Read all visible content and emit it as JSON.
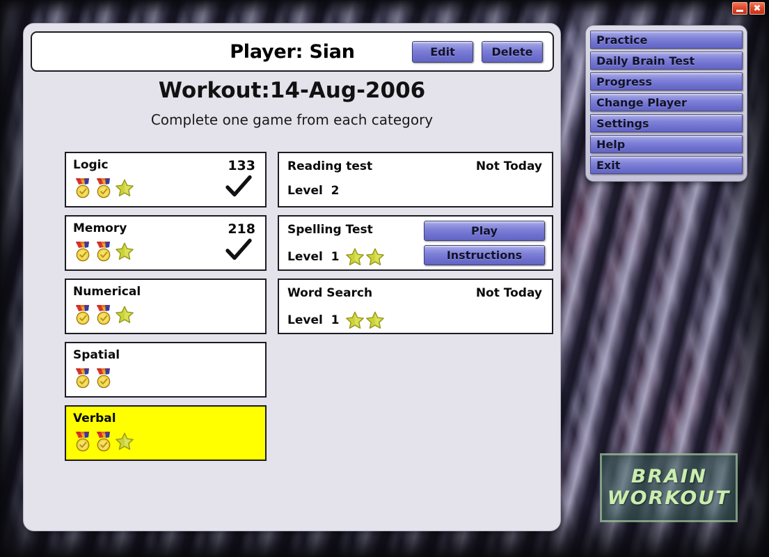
{
  "titlebar": {
    "minimize_label": "minimize",
    "close_label": "✖"
  },
  "header": {
    "player_label": "Player: Sian",
    "edit_label": "Edit",
    "delete_label": "Delete"
  },
  "workout": {
    "title": "Workout:14-Aug-2006",
    "subtitle": "Complete one game from each category"
  },
  "categories": [
    {
      "name": "Logic",
      "score": "133",
      "medals": 2,
      "stars": 1,
      "completed": true,
      "highlighted": false
    },
    {
      "name": "Memory",
      "score": "218",
      "medals": 2,
      "stars": 1,
      "completed": true,
      "highlighted": false
    },
    {
      "name": "Numerical",
      "score": "",
      "medals": 2,
      "stars": 1,
      "completed": false,
      "highlighted": false
    },
    {
      "name": "Spatial",
      "score": "",
      "medals": 2,
      "stars": 0,
      "completed": false,
      "highlighted": false
    },
    {
      "name": "Verbal",
      "score": "",
      "medals": 2,
      "stars": 1,
      "completed": false,
      "highlighted": true
    }
  ],
  "games": [
    {
      "name": "Reading test",
      "status": "Not Today",
      "level_label": "Level  2",
      "stars": 0,
      "has_buttons": false,
      "play_label": "",
      "instructions_label": ""
    },
    {
      "name": "Spelling Test",
      "status": "",
      "level_label": "Level  1",
      "stars": 2,
      "has_buttons": true,
      "play_label": "Play",
      "instructions_label": "Instructions"
    },
    {
      "name": "Word Search",
      "status": "Not Today",
      "level_label": "Level  1",
      "stars": 2,
      "has_buttons": false,
      "play_label": "",
      "instructions_label": ""
    }
  ],
  "menu": {
    "items": [
      {
        "label": "Practice"
      },
      {
        "label": "Daily Brain Test"
      },
      {
        "label": "Progress"
      },
      {
        "label": "Change Player"
      },
      {
        "label": "Settings"
      },
      {
        "label": "Help"
      },
      {
        "label": "Exit"
      }
    ]
  },
  "brand": {
    "line1": "BRAIN",
    "line2": "WORKOUT"
  },
  "colors": {
    "panel_bg": "#e4e2ea",
    "card_bg": "#ffffff",
    "card_border": "#1c1c24",
    "highlight": "#ffff00",
    "button_blue": "#7f81d8",
    "brand_green": "#c9eeae",
    "close_red": "#e2492b"
  }
}
